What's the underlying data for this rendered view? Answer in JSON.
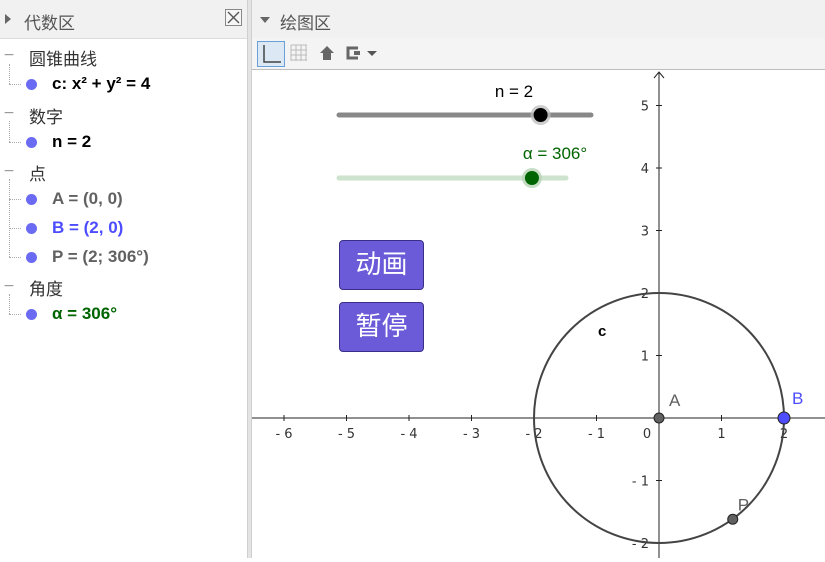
{
  "algebra_view": {
    "title": "代数区",
    "categories": [
      {
        "label": "圆锥曲线",
        "items": [
          {
            "text": "c: x² + y² = 4",
            "color": "#000000"
          }
        ]
      },
      {
        "label": "数字",
        "items": [
          {
            "text": "n = 2",
            "color": "#000000"
          }
        ]
      },
      {
        "label": "点",
        "items": [
          {
            "text": "A = (0, 0)",
            "color": "#616161"
          },
          {
            "text": "B = (2, 0)",
            "color": "#4d4dff"
          },
          {
            "text": "P = (2; 306°)",
            "color": "#616161"
          }
        ]
      },
      {
        "label": "角度",
        "items": [
          {
            "text": "α = 306°",
            "color": "#006400"
          }
        ]
      }
    ]
  },
  "graphics_view": {
    "title": "绘图区",
    "toolbar": [
      "axes-toggle-icon",
      "grid-toggle-icon",
      "home-icon",
      "point-capture-icon",
      "dropdown-arrow-icon"
    ],
    "slider_n": {
      "label": "n = 2",
      "value": 2,
      "min": 0,
      "max": 2.5,
      "color": "#000000",
      "track_color": "#888888"
    },
    "slider_alpha": {
      "label": "α = 306°",
      "value": 306,
      "min": 0,
      "max": 360,
      "color": "#006400",
      "track_color": "#cde3cd"
    },
    "buttons": {
      "animate": "动画",
      "pause": "暂停",
      "color": "#6b5bd8"
    },
    "axes": {
      "x_ticks": [
        "- 6",
        "- 5",
        "- 4",
        "- 3",
        "- 2",
        "- 1",
        "0",
        "1",
        "2"
      ],
      "y_ticks": [
        "5",
        "4",
        "3",
        "2",
        "1",
        "- 1",
        "- 2"
      ]
    },
    "objects": {
      "circle_label": "c",
      "circle": {
        "cx": 0,
        "cy": 0,
        "r": 2
      },
      "points": [
        {
          "label": "A",
          "x": 0,
          "y": 0,
          "color": "#616161"
        },
        {
          "label": "B",
          "x": 2,
          "y": 0,
          "color": "#4d4dff"
        },
        {
          "label": "P",
          "x": 1.18,
          "y": -1.62,
          "color": "#616161"
        }
      ]
    }
  }
}
